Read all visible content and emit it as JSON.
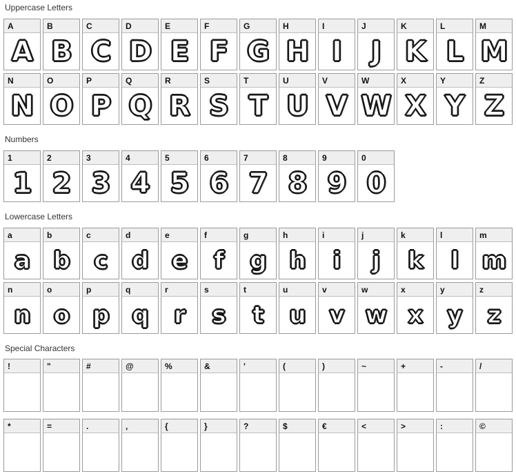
{
  "sections": {
    "uppercase": {
      "title": "Uppercase Letters",
      "chars": [
        "A",
        "B",
        "C",
        "D",
        "E",
        "F",
        "G",
        "H",
        "I",
        "J",
        "K",
        "L",
        "M",
        "N",
        "O",
        "P",
        "Q",
        "R",
        "S",
        "T",
        "U",
        "V",
        "W",
        "X",
        "Y",
        "Z"
      ]
    },
    "numbers": {
      "title": "Numbers",
      "chars": [
        "1",
        "2",
        "3",
        "4",
        "5",
        "6",
        "7",
        "8",
        "9",
        "0"
      ]
    },
    "lowercase": {
      "title": "Lowercase Letters",
      "chars": [
        "a",
        "b",
        "c",
        "d",
        "e",
        "f",
        "g",
        "h",
        "i",
        "j",
        "k",
        "l",
        "m",
        "n",
        "o",
        "p",
        "q",
        "r",
        "s",
        "t",
        "u",
        "v",
        "w",
        "x",
        "y",
        "z"
      ]
    },
    "special": {
      "title": "Special Characters",
      "chars": [
        "!",
        "\"",
        "#",
        "@",
        "%",
        "&",
        "'",
        "(",
        ")",
        "~",
        "+",
        "-",
        "/",
        "*",
        "=",
        ".",
        ",",
        "{",
        "}",
        "?",
        "$",
        "€",
        "<",
        ">",
        ":",
        "©"
      ]
    }
  }
}
